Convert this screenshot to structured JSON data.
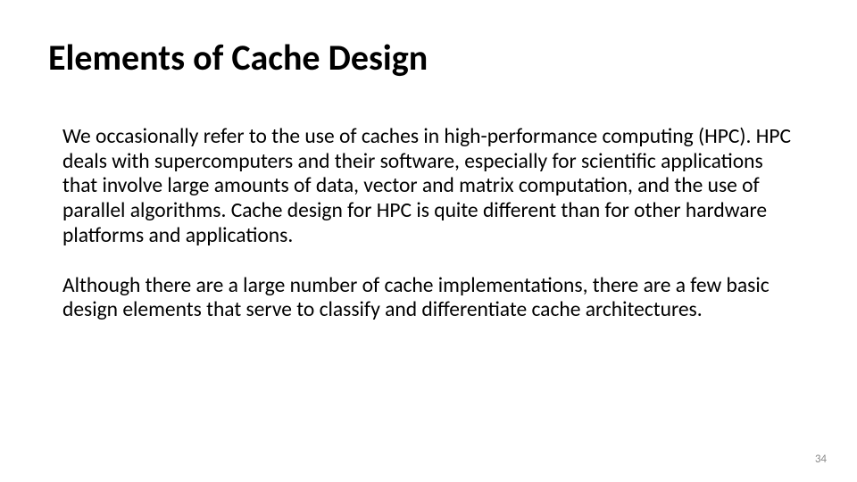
{
  "slide": {
    "title": "Elements of Cache Design",
    "paragraph1": "We occasionally refer to the use of caches in high-performance computing (HPC). HPC deals with supercomputers and their software, especially for scientific applications that involve large amounts of data, vector and matrix computation, and the use of parallel algorithms. Cache design for HPC is quite different than for other hardware platforms and applications.",
    "paragraph2": "Although there are a large number of cache implementations, there are a few basic design elements that serve to classify and differentiate cache architectures.",
    "page_number": "34"
  }
}
